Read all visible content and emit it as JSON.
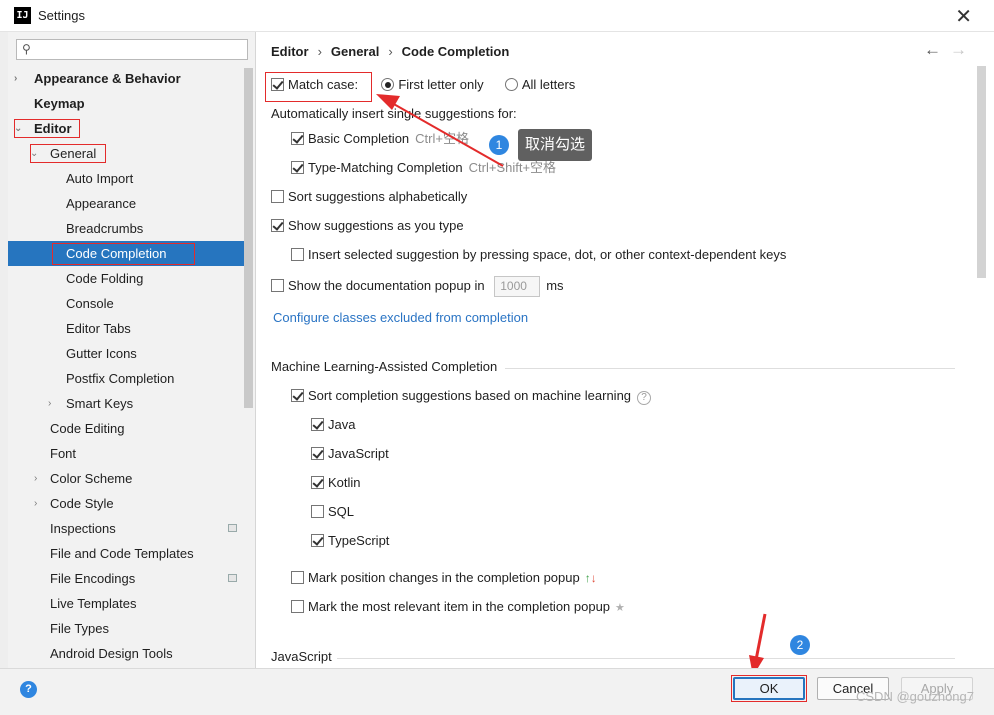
{
  "window": {
    "title": "Settings",
    "app_icon": "IJ"
  },
  "search": {
    "placeholder": "",
    "value": ""
  },
  "sidebar": {
    "items": [
      {
        "label": "Appearance & Behavior",
        "bold": true,
        "arrow": "›"
      },
      {
        "label": "Keymap",
        "bold": true
      },
      {
        "label": "Editor",
        "bold": true,
        "arrow": "⌄"
      },
      {
        "label": "General",
        "arrow": "⌄"
      },
      {
        "label": "Auto Import"
      },
      {
        "label": "Appearance"
      },
      {
        "label": "Breadcrumbs"
      },
      {
        "label": "Code Completion",
        "selected": true
      },
      {
        "label": "Code Folding"
      },
      {
        "label": "Console"
      },
      {
        "label": "Editor Tabs"
      },
      {
        "label": "Gutter Icons"
      },
      {
        "label": "Postfix Completion"
      },
      {
        "label": "Smart Keys",
        "arrow": "›"
      },
      {
        "label": "Code Editing"
      },
      {
        "label": "Font"
      },
      {
        "label": "Color Scheme",
        "arrow": "›"
      },
      {
        "label": "Code Style",
        "arrow": "›"
      },
      {
        "label": "Inspections",
        "badge": true
      },
      {
        "label": "File and Code Templates"
      },
      {
        "label": "File Encodings",
        "badge": true
      },
      {
        "label": "Live Templates"
      },
      {
        "label": "File Types"
      },
      {
        "label": "Android Design Tools"
      }
    ]
  },
  "breadcrumb": [
    "Editor",
    "General",
    "Code Completion"
  ],
  "nav": {
    "back": "←",
    "forward": "→"
  },
  "content": {
    "match_case_label": "Match case:",
    "first_letter_only": "First letter only",
    "all_letters": "All letters",
    "auto_insert_heading": "Automatically insert single suggestions for:",
    "basic_completion": "Basic Completion",
    "basic_completion_hint": "Ctrl+空格",
    "type_matching": "Type-Matching Completion",
    "type_matching_hint": "Ctrl+Shift+空格",
    "sort_alpha": "Sort suggestions alphabetically",
    "show_as_you_type": "Show suggestions as you type",
    "insert_selected": "Insert selected suggestion by pressing space, dot, or other context-dependent keys",
    "show_doc_popup": "Show the documentation popup in",
    "doc_popup_value": "1000",
    "doc_popup_unit": "ms",
    "configure_link": "Configure classes excluded from completion",
    "ml_heading": "Machine Learning-Assisted Completion",
    "ml_sort": "Sort completion suggestions based on machine learning",
    "help_glyph": "?",
    "langs": [
      "Java",
      "JavaScript",
      "Kotlin",
      "SQL",
      "TypeScript"
    ],
    "mark_position": "Mark position changes in the completion popup",
    "mark_position_up": "↑",
    "mark_position_down": "↓",
    "mark_relevant": "Mark the most relevant item in the completion popup",
    "star_glyph": "★",
    "js_heading": "JavaScript"
  },
  "checkbox_states": {
    "match_case": true,
    "basic_completion": true,
    "type_matching": true,
    "sort_alpha": false,
    "show_as_you_type": true,
    "insert_selected": false,
    "show_doc_popup": false,
    "ml_sort": true,
    "langs": [
      true,
      true,
      true,
      false,
      true
    ],
    "mark_position": false,
    "mark_relevant": false
  },
  "radio_selected": "first_letter_only",
  "annotations": {
    "callout1_number": "1",
    "callout1_text": "取消勾选",
    "callout2_number": "2"
  },
  "buttons": {
    "ok": "OK",
    "cancel": "Cancel",
    "apply": "Apply",
    "help": "?"
  },
  "watermark": "CSDN @gouzhong7",
  "colors": {
    "selection": "#2675bf",
    "annotation_red": "#e32b2b",
    "callout_blue": "#2f86e0",
    "link": "#2a74c4"
  }
}
